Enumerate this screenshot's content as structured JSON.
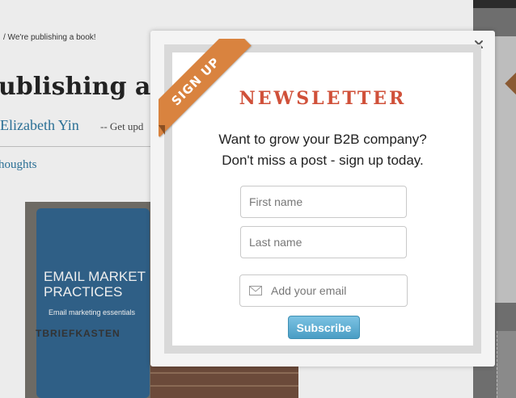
{
  "background": {
    "breadcrumb": "/  We're publishing a book!",
    "title": "ublishing a bo",
    "author": "Elizabeth Yin",
    "author_rest": "-- Get upd",
    "thoughts": "houghts",
    "image_title_line1": "EMAIL MARKET",
    "image_title_line2": "PRACTICES",
    "image_subtitle": "Email marketing essentials",
    "image_box_text": "TBRIEFKASTEN"
  },
  "modal": {
    "ribbon_label": "SIGN UP",
    "heading": "NEWSLETTER",
    "pitch_line1": "Want to grow your B2B company?",
    "pitch_line2": "Don't miss a post - sign up today.",
    "first_name_placeholder": "First name",
    "last_name_placeholder": "Last name",
    "email_placeholder": "Add your email",
    "subscribe_label": "Subscribe"
  },
  "colors": {
    "accent_heading": "#d0513a",
    "ribbon": "#d9833f",
    "button": "#4a9dc4"
  },
  "icons": {
    "close": "close-icon",
    "email": "envelope-icon"
  }
}
